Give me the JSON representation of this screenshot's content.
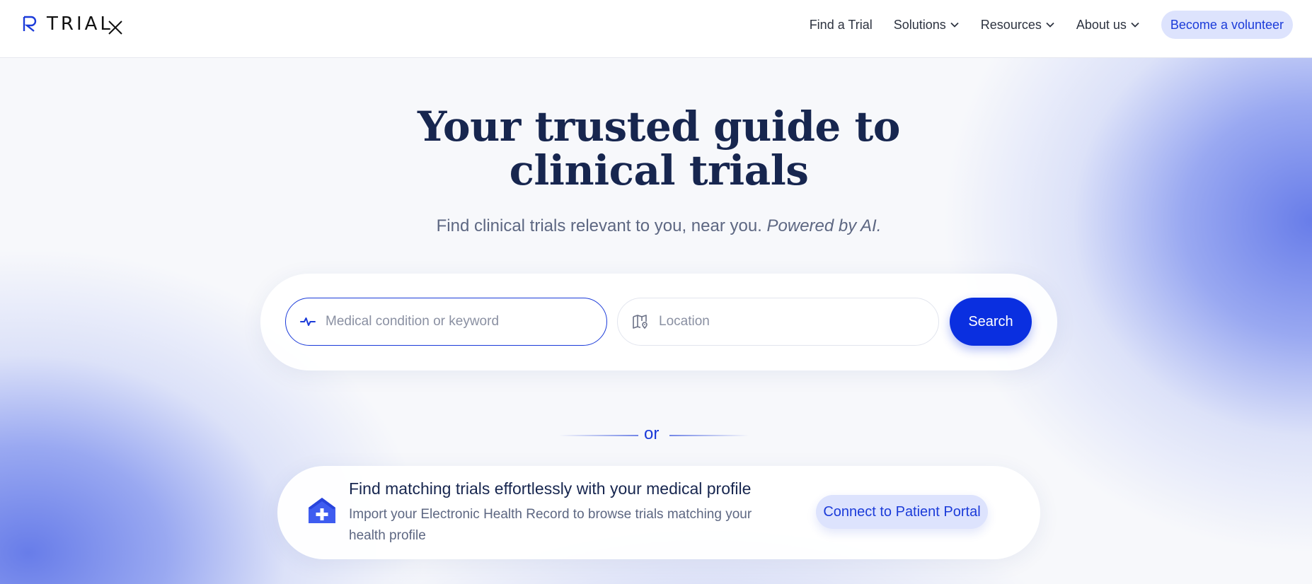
{
  "brand": {
    "name": "TRIAL",
    "suffix": "X"
  },
  "nav": {
    "items": [
      {
        "label": "Find a Trial",
        "dropdown": false
      },
      {
        "label": "Solutions",
        "dropdown": true
      },
      {
        "label": "Resources",
        "dropdown": true
      },
      {
        "label": "About us",
        "dropdown": true
      }
    ],
    "cta_label": "Become a volunteer"
  },
  "hero": {
    "title_line1": "Your trusted guide to",
    "title_line2": "clinical trials",
    "subtitle": "Find clinical trials relevant to you, near you.",
    "subtitle_emphasis": "Powered by AI."
  },
  "search": {
    "condition_placeholder": "Medical condition or keyword",
    "location_placeholder": "Location",
    "button_label": "Search"
  },
  "divider": {
    "label": "or"
  },
  "profile": {
    "title": "Find matching trials effortlessly with your medical profile",
    "description": "Import your Electronic Health Record to browse trials matching your health profile",
    "button_label": "Connect to Patient Portal"
  },
  "colors": {
    "accent": "#0a2fe0",
    "accent_text": "#1b3bd9",
    "accent_soft": "#dde3fd",
    "heading": "#17264f",
    "body_text": "#5d6782"
  },
  "icons": {
    "logo": "trialx-logo-icon",
    "condition": "heartbeat-icon",
    "location": "map-pin-icon",
    "profile": "medical-home-icon",
    "dropdown": "chevron-down-icon"
  }
}
